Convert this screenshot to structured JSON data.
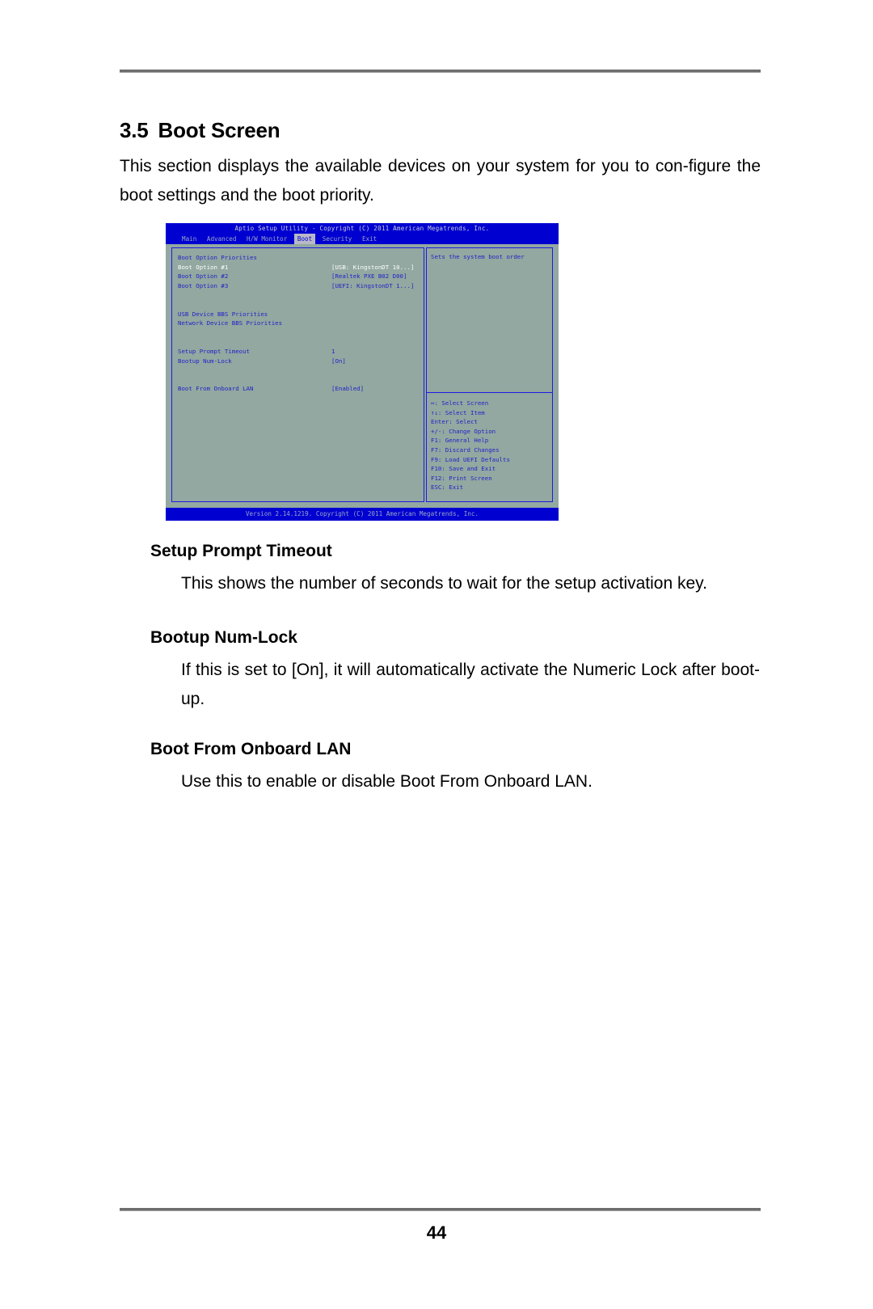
{
  "document": {
    "section_number": "3.5",
    "section_title": "Boot Screen",
    "intro": "This section displays the available devices on your system for you to con-figure the boot settings and the boot priority.",
    "page_number": "44"
  },
  "sections": [
    {
      "heading": "Setup Prompt Timeout",
      "body": "This shows the number of seconds to wait for the setup activation key."
    },
    {
      "heading": "Bootup Num-Lock",
      "body": "If this is set to [On], it will automatically activate the Numeric Lock after boot-up."
    },
    {
      "heading": "Boot From Onboard LAN",
      "body": "Use this to enable or disable Boot From Onboard LAN."
    }
  ],
  "bios": {
    "title": "Aptio Setup Utility - Copyright (C) 2011 American Megatrends, Inc.",
    "menu_tabs": [
      {
        "label": "Main",
        "active": false
      },
      {
        "label": "Advanced",
        "active": false
      },
      {
        "label": "H/W Monitor",
        "active": false
      },
      {
        "label": "Boot",
        "active": true
      },
      {
        "label": "Security",
        "active": false
      },
      {
        "label": "Exit",
        "active": false
      }
    ],
    "group_heading": "Boot Option Priorities",
    "options": [
      {
        "label": "Boot Option #1",
        "value": "[USB: KingstonDT 10...]",
        "selected": true
      },
      {
        "label": "Boot Option #2",
        "value": "[Realtek PXE B02 D00]",
        "selected": false
      },
      {
        "label": "Boot Option #3",
        "value": "[UEFI: KingstonDT 1...]",
        "selected": false
      }
    ],
    "submenus": [
      "USB Device BBS Priorities",
      "Network Device BBS Priorities"
    ],
    "settings": [
      {
        "label": "Setup Prompt Timeout",
        "value": "1"
      },
      {
        "label": "Bootup Num-Lock",
        "value": "[On]"
      }
    ],
    "lan_setting": {
      "label": "Boot From Onboard LAN",
      "value": "[Enabled]"
    },
    "help_text": "Sets the system boot order",
    "nav_keys": [
      "↔: Select Screen",
      "↑↓: Select Item",
      "Enter: Select",
      "+/-: Change Option",
      "F1: General Help",
      "F7: Discard Changes",
      "F9: Load UEFI Defaults",
      "F10: Save and Exit",
      "F12: Print Screen",
      "ESC: Exit"
    ],
    "version_bar": "Version 2.14.1219. Copyright (C) 2011 American Megatrends, Inc.",
    "colors": {
      "panel_bg": "#92a8a0",
      "bar_blue": "#0000d0",
      "text_blue": "#2323c8",
      "selected_text": "#ffffff"
    }
  }
}
